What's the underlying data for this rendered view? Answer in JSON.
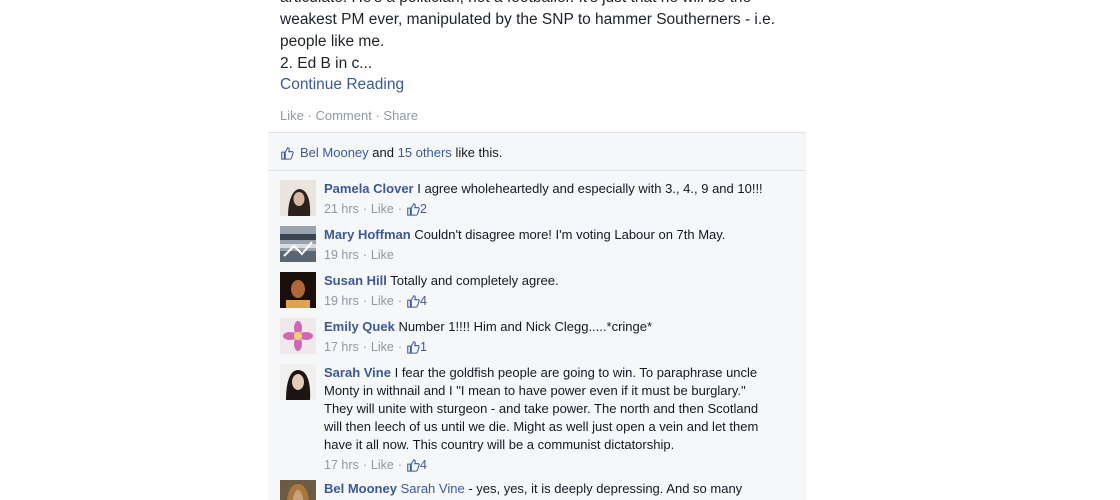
{
  "post": {
    "text_lines": [
      "articulate. He's a politician, not a footballer. It's just that he will be the",
      "weakest PM ever, manipulated by the SNP to hammer Southerners - i.e.",
      "people like me.",
      "2. Ed B in c..."
    ],
    "continue_label": "Continue Reading",
    "actions": {
      "like": "Like",
      "comment": "Comment",
      "share": "Share",
      "separator": "·"
    }
  },
  "likes": {
    "name": "Bel Mooney",
    "and": "and",
    "others": "15 others",
    "suffix": "like this."
  },
  "comments": [
    {
      "name": "Pamela Clover",
      "text": "I agree wholeheartedly and especially with 3., 4., 9 and 10!!!",
      "time": "21 hrs",
      "like": "Like",
      "count": "2"
    },
    {
      "name": "Mary Hoffman",
      "text": "Couldn't disagree more! I'm voting Labour on 7th May.",
      "time": "19 hrs",
      "like": "Like",
      "count": ""
    },
    {
      "name": "Susan Hill",
      "text": "Totally and completely agree.",
      "time": "19 hrs",
      "like": "Like",
      "count": "4"
    },
    {
      "name": "Emily Quek",
      "text": "Number 1!!!! Him and Nick Clegg.....*cringe*",
      "time": "17 hrs",
      "like": "Like",
      "count": "1"
    },
    {
      "name": "Sarah Vine",
      "text_lines": [
        "I fear the goldfish people are going to win. To paraphrase uncle",
        "Monty in withnail and I \"I mean to have power even if it must be burglary.\"",
        "They will unite with sturgeon - and take power. The north and then Scotland",
        "will then leech of us until we die. Might as well just open a vein and let them",
        "have it all now. This country will be a communist dictatorship."
      ],
      "time": "17 hrs",
      "like": "Like",
      "count": "4"
    },
    {
      "name": "Bel Mooney",
      "mention": "Sarah Vine",
      "text": "- yes, yes, it is deeply depressing. And so many"
    }
  ],
  "colors": {
    "link": "#3b5998",
    "meta": "#9197a3",
    "ufi_bg": "#f6f7f9"
  }
}
